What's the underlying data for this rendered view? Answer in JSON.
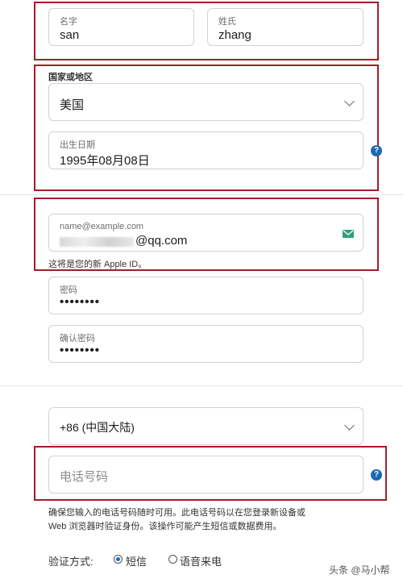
{
  "name": {
    "first_label": "名字",
    "first_value": "san",
    "last_label": "姓氏",
    "last_value": "zhang"
  },
  "country": {
    "heading": "国家或地区",
    "value": "美国"
  },
  "birthday": {
    "label": "出生日期",
    "value": "1995年08月08日"
  },
  "email": {
    "placeholder": "name@example.com",
    "value_suffix": "@qq.com",
    "note": "这将是您的新 Apple ID。"
  },
  "password": {
    "label": "密码",
    "value": "••••••••"
  },
  "confirm_password": {
    "label": "确认密码",
    "value": "••••••••"
  },
  "phone": {
    "country_code": "+86 (中国大陆)",
    "placeholder": "电话号码",
    "notice_line1": "确保您输入的电话号码随时可用。此电话号码以在您登录新设备或",
    "notice_line2": "Web 浏览器时验证身份。该操作可能产生短信或数据费用。"
  },
  "verification": {
    "label": "验证方式:",
    "option_sms": "短信",
    "option_voice": "语音来电",
    "selected": "短信"
  },
  "help_icon_text": "?",
  "watermark": "头条 @马小帮",
  "colors": {
    "highlight_border": "#a31d26",
    "help_icon": "#1d68b3",
    "email_icon": "#2e9e7b"
  }
}
